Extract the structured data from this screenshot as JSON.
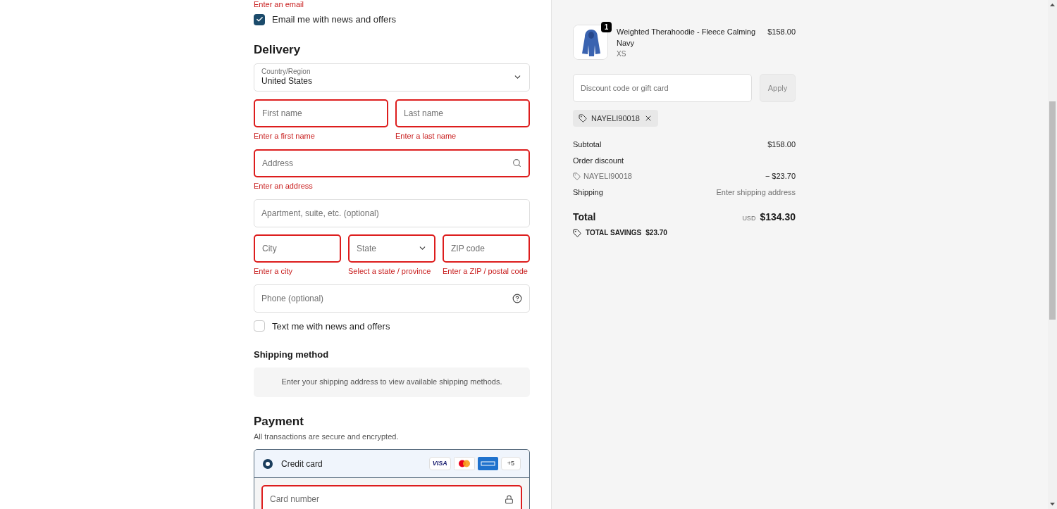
{
  "contact": {
    "error": "Enter an email",
    "newsletter": {
      "label": "Email me with news and offers",
      "checked": true
    }
  },
  "delivery": {
    "title": "Delivery",
    "country": {
      "label": "Country/Region",
      "value": "United States"
    },
    "rows": [
      {
        "fields": [
          {
            "kind": "input",
            "placeholder": "First name",
            "invalid": true,
            "error": "Enter a first name"
          },
          {
            "kind": "input",
            "placeholder": "Last name",
            "invalid": true,
            "error": "Enter a last name"
          }
        ]
      },
      {
        "fields": [
          {
            "kind": "search",
            "placeholder": "Address",
            "invalid": true,
            "error": "Enter an address"
          }
        ]
      },
      {
        "fields": [
          {
            "kind": "input",
            "placeholder": "Apartment, suite, etc. (optional)",
            "invalid": false
          }
        ]
      },
      {
        "fields": [
          {
            "kind": "input",
            "placeholder": "City",
            "invalid": true,
            "error": "Enter a city"
          },
          {
            "kind": "select",
            "placeholder": "State",
            "invalid": true,
            "error": "Select a state / province"
          },
          {
            "kind": "input",
            "placeholder": "ZIP code",
            "invalid": true,
            "error": "Enter a ZIP / postal code"
          }
        ]
      },
      {
        "fields": [
          {
            "kind": "help",
            "placeholder": "Phone (optional)",
            "invalid": false
          }
        ]
      }
    ],
    "sms": {
      "label": "Text me with news and offers",
      "checked": false
    }
  },
  "shipping_method": {
    "title": "Shipping method",
    "notice": "Enter your shipping address to view available shipping methods."
  },
  "payment": {
    "title": "Payment",
    "subtitle": "All transactions are secure and encrypted.",
    "method": {
      "label": "Credit card",
      "selected": true,
      "brands": [
        "VISA",
        "+5"
      ]
    },
    "card_number": {
      "placeholder": "Card number",
      "invalid": true
    }
  },
  "summary": {
    "item": {
      "quantity": "1",
      "name": "Weighted Therahoodie - Fleece Calming",
      "variant": "Navy",
      "size": "XS",
      "price": "$158.00"
    },
    "discount": {
      "placeholder": "Discount code or gift card",
      "button": "Apply",
      "code": "NAYELI90018"
    },
    "lines": [
      {
        "label": "Subtotal",
        "value": "$158.00"
      },
      {
        "label": "Order discount"
      },
      {
        "label": "NAYELI90018",
        "value": "− $23.70",
        "kind": "code"
      },
      {
        "label": "Shipping",
        "value": "Enter shipping address",
        "kind": "muted"
      }
    ],
    "total": {
      "label": "Total",
      "currency": "USD",
      "value": "$134.30"
    },
    "savings": {
      "label": "TOTAL SAVINGS",
      "value": "$23.70"
    }
  }
}
